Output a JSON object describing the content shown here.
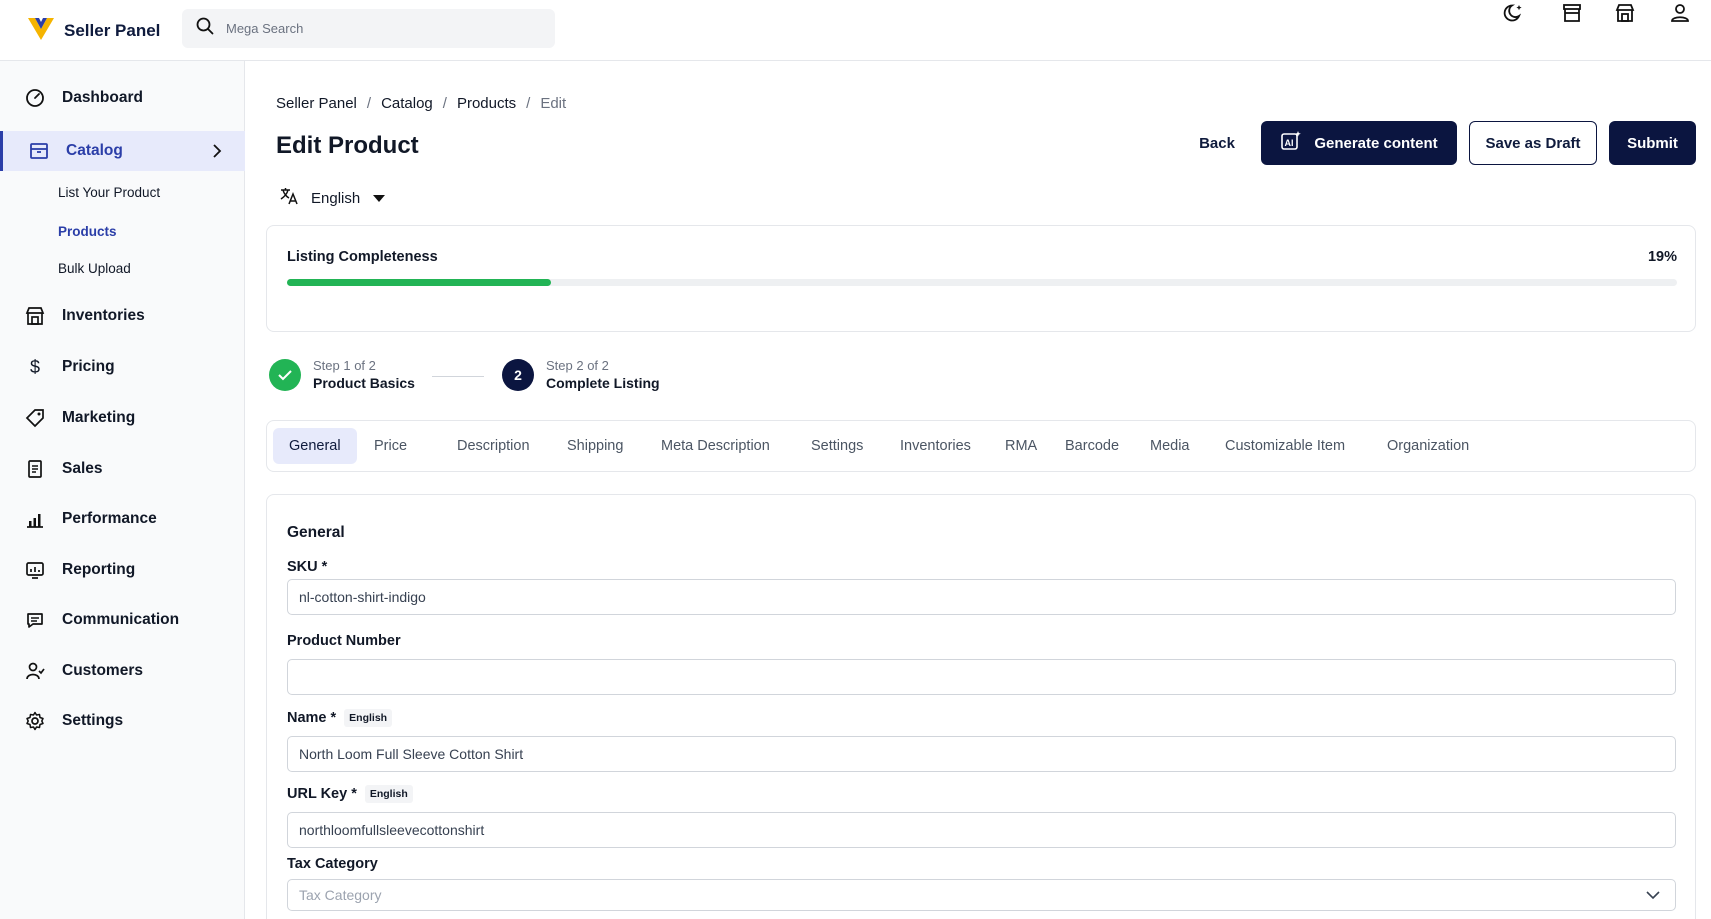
{
  "app": {
    "name": "Seller Panel"
  },
  "search": {
    "placeholder": "Mega Search"
  },
  "sidebar": {
    "items": [
      {
        "label": "Dashboard",
        "icon": "dashboard-icon"
      },
      {
        "label": "Catalog",
        "icon": "catalog-icon",
        "active": true
      },
      {
        "label": "Inventories",
        "icon": "store-icon"
      },
      {
        "label": "Pricing",
        "icon": "dollar-icon"
      },
      {
        "label": "Marketing",
        "icon": "tag-icon"
      },
      {
        "label": "Sales",
        "icon": "receipt-icon"
      },
      {
        "label": "Performance",
        "icon": "bar-chart-icon"
      },
      {
        "label": "Reporting",
        "icon": "report-icon"
      },
      {
        "label": "Communication",
        "icon": "chat-icon"
      },
      {
        "label": "Customers",
        "icon": "customers-icon"
      },
      {
        "label": "Settings",
        "icon": "gear-icon"
      }
    ],
    "catalog_sub": [
      "List Your Product",
      "Products",
      "Bulk Upload"
    ]
  },
  "breadcrumb": [
    "Seller Panel",
    "Catalog",
    "Products",
    "Edit"
  ],
  "page": {
    "title": "Edit Product",
    "language": "English"
  },
  "buttons": {
    "back": "Back",
    "generate": "Generate content",
    "draft": "Save as Draft",
    "submit": "Submit"
  },
  "completeness": {
    "label": "Listing Completeness",
    "percent_label": "19%",
    "value": 0.19
  },
  "steps": [
    {
      "small": "Step 1 of 2",
      "title": "Product Basics",
      "done": true
    },
    {
      "number": "2",
      "small": "Step 2 of 2",
      "title": "Complete Listing"
    }
  ],
  "tabs": [
    "General",
    "Price",
    "Description",
    "Shipping",
    "Meta Description",
    "Settings",
    "Inventories",
    "RMA",
    "Barcode",
    "Media",
    "Customizable Item",
    "Organization"
  ],
  "form": {
    "title": "General",
    "sku": {
      "label": "SKU *",
      "value": "nl-cotton-shirt-indigo"
    },
    "product_number": {
      "label": "Product Number",
      "value": ""
    },
    "name": {
      "label": "Name *",
      "tag": "English",
      "value": "North Loom Full Sleeve Cotton Shirt"
    },
    "url_key": {
      "label": "URL Key *",
      "tag": "English",
      "value": "northloomfullsleevecottonshirt"
    },
    "tax_category": {
      "label": "Tax Category",
      "placeholder": "Tax Category"
    }
  },
  "colors": {
    "accent": "#2b3ea8",
    "navy": "#0b1540",
    "success": "#22b455",
    "brand_yellow": "#f5b400"
  }
}
